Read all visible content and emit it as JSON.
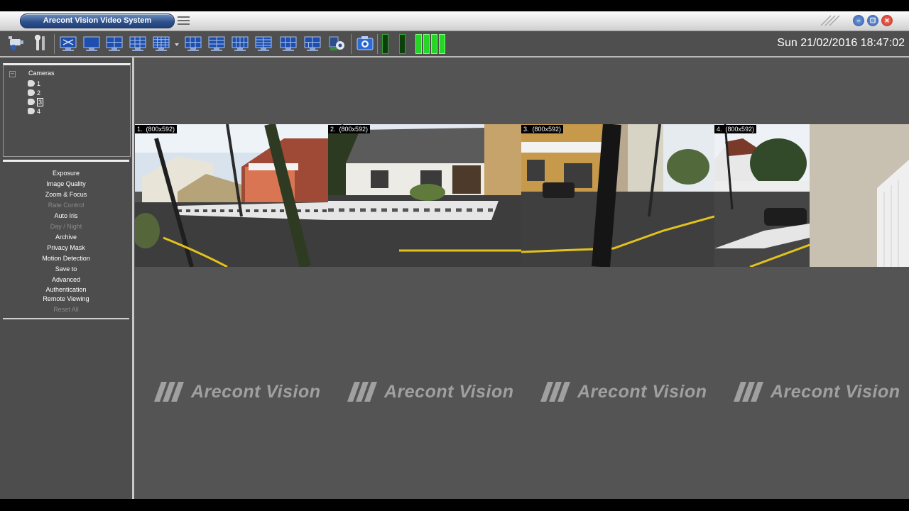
{
  "app": {
    "title": "Arecont Vision Video System"
  },
  "window_controls": {
    "minimize": "–",
    "restore": "❐",
    "close": "✕"
  },
  "clock": "Sun 21/02/2016 18:47:02",
  "tree": {
    "root_label": "Cameras",
    "expand_glyph": "–",
    "cameras": [
      {
        "label": "1",
        "selected": false
      },
      {
        "label": "2",
        "selected": false
      },
      {
        "label": "3",
        "selected": true
      },
      {
        "label": "4",
        "selected": false
      }
    ]
  },
  "menu": [
    {
      "label": "Exposure",
      "enabled": true
    },
    {
      "label": "Image Quality",
      "enabled": true
    },
    {
      "label": "Zoom & Focus",
      "enabled": true
    },
    {
      "label": "Rate Control",
      "enabled": false
    },
    {
      "label": "Auto Iris",
      "enabled": true
    },
    {
      "label": "Day / Night",
      "enabled": false
    },
    {
      "label": "Archive",
      "enabled": true
    },
    {
      "label": "Privacy Mask",
      "enabled": true
    },
    {
      "label": "Motion Detection",
      "enabled": true
    },
    {
      "label": "Save to",
      "enabled": true
    },
    {
      "label": "Advanced",
      "enabled": true
    },
    {
      "label": "Authentication",
      "enabled": true
    },
    {
      "label": "Remote Viewing",
      "enabled": true
    },
    {
      "label": "Reset All",
      "enabled": false
    }
  ],
  "feeds": [
    {
      "label": "1.  (800x592)"
    },
    {
      "label": "2.  (800x592)"
    },
    {
      "label": "3.  (800x592)"
    },
    {
      "label": "4.  (800x592)"
    }
  ],
  "watermark": {
    "text": "Arecont Vision"
  },
  "colors": {
    "accent": "#2c4f8a",
    "meter_on": "#26d526",
    "meter_off": "#0b3f0b",
    "panel": "#4d4d4d",
    "main": "#545454"
  }
}
